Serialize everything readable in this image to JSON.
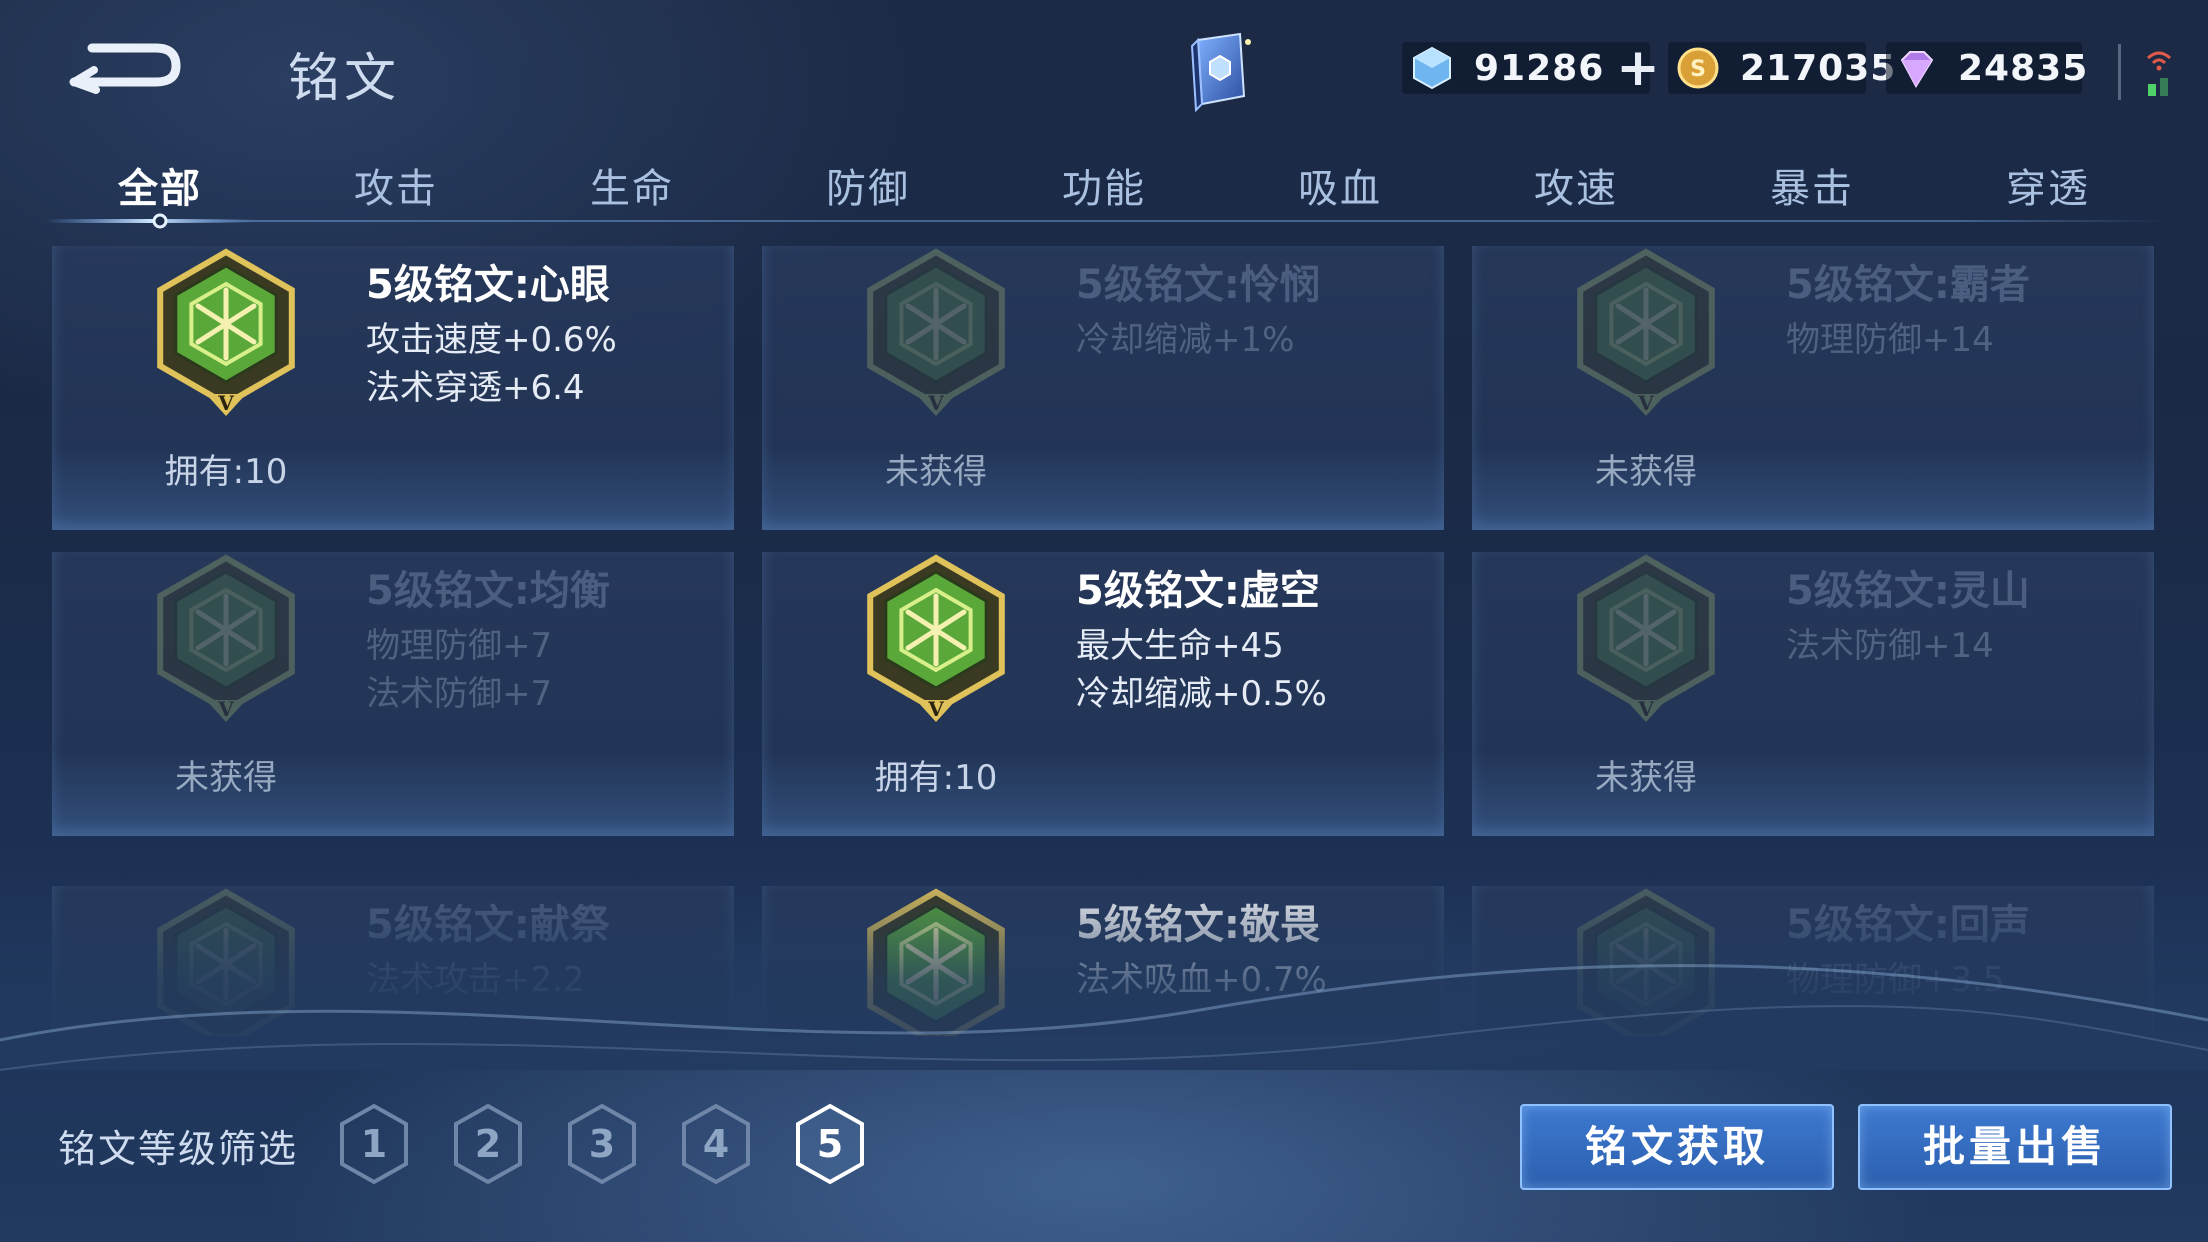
{
  "header": {
    "title": "铭文",
    "back_icon": "back-arrow-icon",
    "book_icon": "rune-book-icon",
    "currencies": [
      {
        "icon": "diamond-gem-icon",
        "value": "91286",
        "has_plus": true,
        "plus_label": "+"
      },
      {
        "icon": "gold-coin-icon",
        "value": "217035"
      },
      {
        "icon": "purple-crystal-icon",
        "value": "24835"
      }
    ]
  },
  "tabs": [
    "全部",
    "攻击",
    "生命",
    "防御",
    "功能",
    "吸血",
    "攻速",
    "暴击",
    "穿透"
  ],
  "active_tab": "全部",
  "cards": [
    {
      "name": "5级铭文:心眼",
      "stats": [
        "攻击速度+0.6%",
        "法术穿透+6.4"
      ],
      "status": "拥有:10",
      "owned": true,
      "color": "#e0c25a"
    },
    {
      "name": "5级铭文:怜悯",
      "stats": [
        "冷却缩减+1%"
      ],
      "status": "未获得",
      "owned": false,
      "color": "#9ab06a"
    },
    {
      "name": "5级铭文:霸者",
      "stats": [
        "物理防御+14"
      ],
      "status": "未获得",
      "owned": false,
      "color": "#9ab06a"
    },
    {
      "name": "5级铭文:均衡",
      "stats": [
        "物理防御+7",
        "法术防御+7"
      ],
      "status": "未获得",
      "owned": false,
      "color": "#9ab06a"
    },
    {
      "name": "5级铭文:虚空",
      "stats": [
        "最大生命+45",
        "冷却缩减+0.5%"
      ],
      "status": "拥有:10",
      "owned": true,
      "color": "#e0c25a"
    },
    {
      "name": "5级铭文:灵山",
      "stats": [
        "法术防御+14"
      ],
      "status": "未获得",
      "owned": false,
      "color": "#9ab06a"
    },
    {
      "name": "5级铭文:献祭",
      "stats": [
        "法术攻击+2.2"
      ],
      "status": "",
      "owned": false,
      "color": "#9ab06a"
    },
    {
      "name": "5级铭文:敬畏",
      "stats": [
        "法术吸血+0.7%"
      ],
      "status": "",
      "owned": true,
      "color": "#e0c25a"
    },
    {
      "name": "5级铭文:回声",
      "stats": [
        "物理防御+3.5"
      ],
      "status": "",
      "owned": false,
      "color": "#9ab06a"
    }
  ],
  "footer": {
    "filter_label": "铭文等级筛选",
    "levels": [
      "1",
      "2",
      "3",
      "4",
      "5"
    ],
    "active_level": "5",
    "acquire_button": "铭文获取",
    "sell_button": "批量出售"
  }
}
